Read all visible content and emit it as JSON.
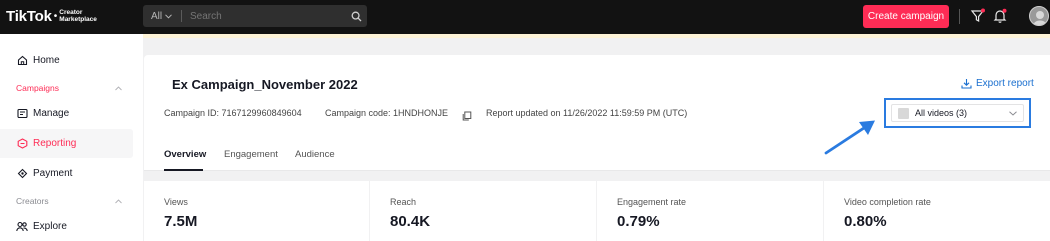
{
  "header": {
    "logo_main": "TikTok",
    "logo_sub_line1": "Creator",
    "logo_sub_line2": "Marketplace",
    "search_scope": "All",
    "search_placeholder": "Search",
    "create_button": "Create campaign",
    "accent_color": "#fe2c55"
  },
  "sidebar": {
    "home": "Home",
    "campaigns_group": "Campaigns",
    "manage": "Manage",
    "reporting": "Reporting",
    "payment": "Payment",
    "creators_group": "Creators",
    "explore": "Explore"
  },
  "campaign": {
    "title": "Ex Campaign_November 2022",
    "export_label": "Export report",
    "id_text": "Campaign ID: 7167129960849604",
    "code_text": "Campaign code: 1HNDHONJE",
    "updated_text": "Report updated on 11/26/2022 11:59:59 PM (UTC)",
    "video_select": "All videos (3)"
  },
  "tabs": [
    "Overview",
    "Engagement",
    "Audience"
  ],
  "stats": [
    {
      "label": "Views",
      "value": "7.5M"
    },
    {
      "label": "Reach",
      "value": "80.4K"
    },
    {
      "label": "Engagement rate",
      "value": "0.79%"
    },
    {
      "label": "Video completion rate",
      "value": "0.80%"
    }
  ]
}
